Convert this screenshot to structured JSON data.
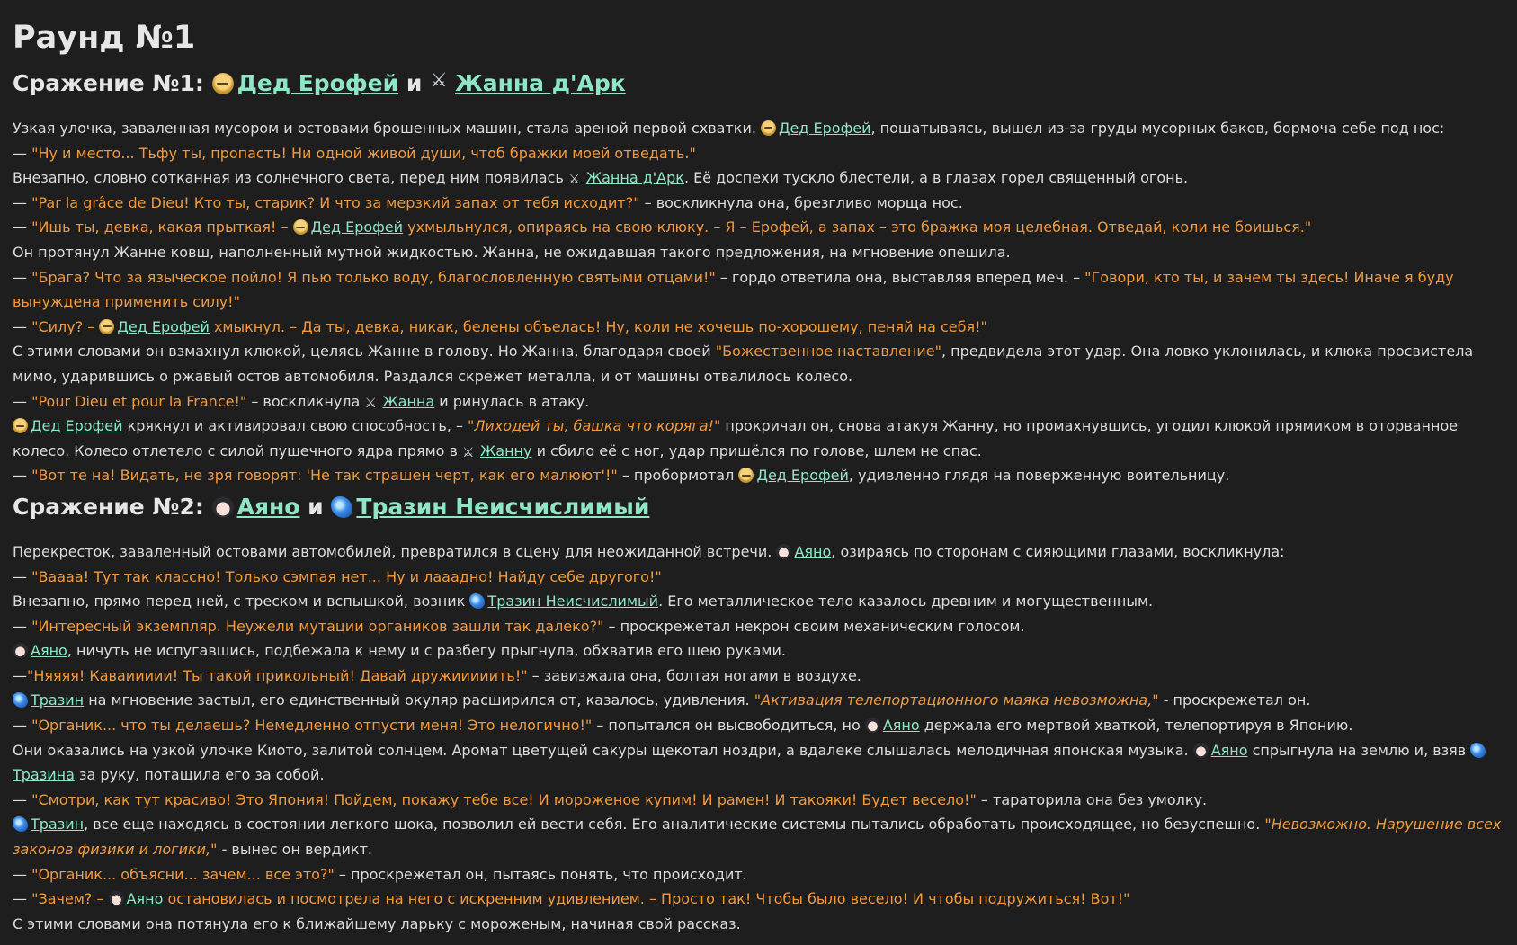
{
  "title": "Раунд №1",
  "icons": {
    "old": "old-man-face-icon",
    "sword": "crossed-swords-icon",
    "girl": "anime-girl-face-icon",
    "gem": "blue-gem-icon"
  },
  "colors": {
    "background": "#1e1e1e",
    "text": "#dcdcdc",
    "speech": "#f29a3e",
    "link": "#8ee6c4"
  },
  "b1": {
    "heading": {
      "pre": "Сражение №1:",
      "and": "и",
      "c1": "Дед Ерофей",
      "c2": "Жанна д'Арк"
    },
    "l1": {
      "t1": "Узкая улочка, заваленная мусором и остовами брошенных машин, стала ареной первой схватки.",
      "c": "Дед Ерофей",
      "t2": ", пошатываясь, вышел из-за груды мусорных баков, бормоча себе под нос:"
    },
    "l2": {
      "dash": "— ",
      "q": "\"Ну и место... Тьфу ты, пропасть! Ни одной живой души, чтоб бражки моей отведать.\""
    },
    "l3": {
      "t1": "Внезапно, словно сотканная из солнечного света, перед ним появилась",
      "c": "Жанна д'Арк",
      "t2": ". Её доспехи тускло блестели, а в глазах горел священный огонь."
    },
    "l4": {
      "dash": "— ",
      "q": "\"Par la grâce de Dieu! Кто ты, старик? И что за мерзкий запах от тебя исходит?\"",
      "t": " – воскликнула она, брезгливо морща нос."
    },
    "l5": {
      "dash": "— ",
      "q1": "\"Ишь ты, девка, какая прыткая! –",
      "c": "Дед Ерофей",
      "q2": " ухмыльнулся, опираясь на свою клюку. – Я – Ерофей, а запах – это бражка моя целебная. Отведай, коли не боишься.\""
    },
    "l6": {
      "t": "Он протянул Жанне ковш, наполненный мутной жидкостью. Жанна, не ожидавшая такого предложения, на мгновение опешила."
    },
    "l7": {
      "dash": "— ",
      "q1": "\"Брага? Что за языческое пойло! Я пью только воду, благословленную святыми отцами!\"",
      "t": " – гордо ответила она, выставляя вперед меч. – ",
      "q2": "\"Говори, кто ты, и зачем ты здесь! Иначе я буду вынуждена применить силу!\""
    },
    "l8": {
      "dash": "— ",
      "q1": "\"Силу? –",
      "c": "Дед Ерофей",
      "q2": " хмыкнул. – Да ты, девка, никак, белены объелась! Ну, коли не хочешь по-хорошему, пеняй на себя!\""
    },
    "l9": {
      "t1": "С этими словами он взмахнул клюкой, целясь Жанне в голову. Но Жанна, благодаря своей ",
      "q": "\"Божественное наставление\"",
      "t2": ", предвидела этот удар. Она ловко уклонилась, и клюка просвистела мимо, ударившись о ржавый остов автомобиля. Раздался скрежет металла, и от машины отвалилось колесо."
    },
    "l10": {
      "dash": "— ",
      "q": "\"Pour Dieu et pour la France!\"",
      "t1": " – воскликнула",
      "c": "Жанна",
      "t2": " и ринулась в атаку."
    },
    "l11": {
      "c1": "Дед Ерофей",
      "t1": " крякнул и активировал свою способность, – ",
      "q": "\"Лиходей ты, башка что коряга!\"",
      "t2": " прокричал он, снова атакуя Жанну, но промахнувшись, угодил клюкой прямиком в оторванное колесо. Колесо отлетело с силой пушечного ядра прямо в",
      "c2": "Жанну",
      "t3": " и сбило её с ног, удар пришёлся по голове, шлем не спас."
    },
    "l12": {
      "dash": "— ",
      "q": "\"Вот те на! Видать, не зря говорят: 'Не так страшен черт, как его малюют'!\"",
      "t1": " – пробормотал",
      "c": "Дед Ерофей",
      "t2": ", удивленно глядя на поверженную воительницу."
    }
  },
  "b2": {
    "heading": {
      "pre": "Сражение №2:",
      "and": "и",
      "c1": "Аяно",
      "c2": "Тразин Неисчислимый"
    },
    "l1": {
      "t1": "Перекресток, заваленный остовами автомобилей, превратился в сцену для неожиданной встречи.",
      "c": "Аяно",
      "t2": ", озираясь по сторонам с сияющими глазами, воскликнула:"
    },
    "l2": {
      "dash": "— ",
      "q": "\"Ваааа! Тут так классно! Только сэмпая нет... Ну и лааадно! Найду себе другого!\""
    },
    "l3": {
      "t1": "Внезапно, прямо перед ней, с треском и вспышкой, возник",
      "c": "Тразин Неисчислимый",
      "t2": ". Его металлическое тело казалось древним и могущественным."
    },
    "l4": {
      "dash": "— ",
      "q": "\"Интересный экземпляр. Неужели мутации органиков зашли так далеко?\"",
      "t": " – проскрежетал некрон своим механическим голосом."
    },
    "l5": {
      "c": "Аяно",
      "t": ", ничуть не испугавшись, подбежала к нему и с разбегу прыгнула, обхватив его шею руками."
    },
    "l6": {
      "dash": "—",
      "q": "\"Няяяя! Каваиииии! Ты такой прикольный! Давай дружииииить!\"",
      "t": " – завизжала она, болтая ногами в воздухе."
    },
    "l7": {
      "c": "Тразин",
      "t1": " на мгновение застыл, его единственный окуляр расширился от, казалось, удивления. ",
      "q": "\"Активация телепортационного маяка невозможна,\"",
      "t2": " - проскрежетал он."
    },
    "l8": {
      "dash": "— ",
      "q": "\"Органик... что ты делаешь? Немедленно отпусти меня! Это нелогично!\"",
      "t1": " – попытался он высвободиться, но",
      "c": "Аяно",
      "t2": " держала его мертвой хваткой, телепортируя в Японию."
    },
    "l9": {
      "t1": "Они оказались на узкой улочке Киото, залитой солнцем. Аромат цветущей сакуры щекотал ноздри, а вдалеке слышалась мелодичная японская музыка.",
      "c1": "Аяно",
      "t2": " спрыгнула на землю и, взяв",
      "c2": "Тразина",
      "t3": " за руку, потащила его за собой."
    },
    "l10": {
      "dash": "— ",
      "q": "\"Смотри, как тут красиво! Это Япония! Пойдем, покажу тебе все! И мороженое купим! И рамен! И такояки! Будет весело!\"",
      "t": " – тараторила она без умолку."
    },
    "l11": {
      "c": "Тразин",
      "t": ", все еще находясь в состоянии легкого шока, позволил ей вести себя. Его аналитические системы пытались обработать происходящее, но безуспешно. ",
      "q": "\"Невозможно. Нарушение всех законов физики и логики,\"",
      "t2": " - вынес он вердикт."
    },
    "l12": {
      "dash": "— ",
      "q": "\"Органик... объясни... зачем... все это?\"",
      "t": " – проскрежетал он, пытаясь понять, что происходит."
    },
    "l13": {
      "dash": "— ",
      "q1": "\"Зачем? –",
      "c": "Аяно",
      "q2": " остановилась и посмотрела на него с искренним удивлением. – Просто так! Чтобы было весело! И чтобы подружиться! Вот!\""
    },
    "l14": {
      "t": "С этими словами она потянула его к ближайшему ларьку с мороженым, начиная свой рассказ."
    }
  }
}
